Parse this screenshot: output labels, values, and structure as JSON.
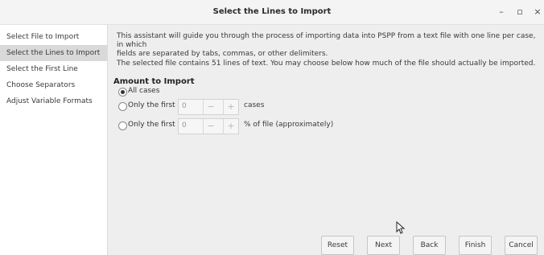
{
  "window": {
    "title": "Select the Lines to Import",
    "minimize": "–",
    "maximize": "▫",
    "close": "×"
  },
  "sidebar": {
    "items": [
      {
        "label": "Select File to Import"
      },
      {
        "label": "Select the Lines to Import"
      },
      {
        "label": "Select the First Line"
      },
      {
        "label": "Choose Separators"
      },
      {
        "label": "Adjust Variable Formats"
      }
    ]
  },
  "main": {
    "intro_line1": "This assistant will guide you through the process of importing data into PSPP from a text file with one line per case, in which",
    "intro_line2": "fields are separated by tabs, commas, or other delimiters.",
    "info": "The selected file contains 51 lines of text. You may choose below how much of the file should actually be imported.",
    "amount": {
      "title": "Amount to Import",
      "options": [
        {
          "label": "All cases",
          "selected": true
        },
        {
          "label": "Only the first",
          "value": "0",
          "unit": "cases",
          "selected": false
        },
        {
          "label": "Only the first",
          "value": "0",
          "unit": "% of file (approximately)",
          "selected": false
        }
      ],
      "minus": "−",
      "plus": "+"
    }
  },
  "buttons": {
    "reset": "Reset",
    "next": "Next",
    "back": "Back",
    "finish": "Finish",
    "cancel": "Cancel"
  }
}
